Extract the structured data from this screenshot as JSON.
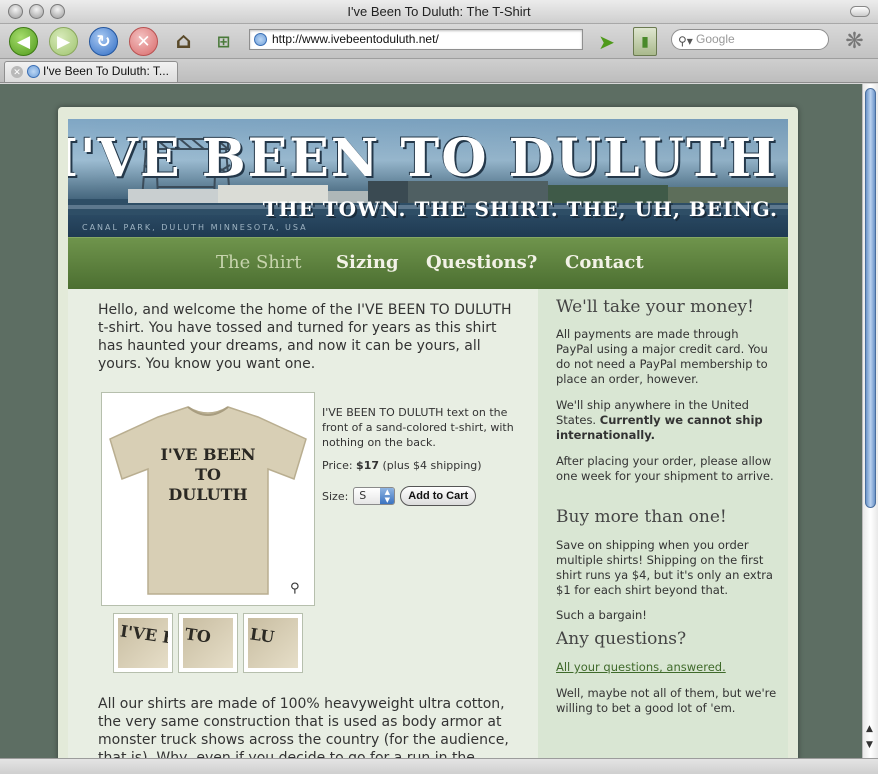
{
  "window": {
    "title": "I've Been To Duluth: The T-Shirt"
  },
  "toolbar": {
    "url": "http://www.ivebeentoduluth.net/",
    "search_placeholder": "Google"
  },
  "tabs": [
    {
      "label": "I've Been To Duluth: T..."
    }
  ],
  "banner": {
    "title": "I'VE BEEN TO DULUTH",
    "subtitle": "THE TOWN.  THE SHIRT.  THE, UH, BEING.",
    "caption": "CANAL PARK, DULUTH MINNESOTA, USA"
  },
  "nav": {
    "items": [
      {
        "label": "The Shirt"
      },
      {
        "label": "Sizing"
      },
      {
        "label": "Questions?"
      },
      {
        "label": "Contact"
      }
    ]
  },
  "main": {
    "intro": "Hello, and welcome the home of the I'VE BEEN TO DULUTH t-shirt. You have tossed and turned for years as this shirt has haunted your dreams, and now it can be yours, all yours. You know you want one.",
    "shirt_print": [
      "I'VE BEEN",
      "TO",
      "DULUTH"
    ],
    "product_description": "I'VE BEEN TO DULUTH text on the front of a sand-colored t-shirt, with nothing on the back.",
    "price_label": "Price:",
    "price_value": "$17",
    "price_note": "(plus $4 shipping)",
    "size_label": "Size:",
    "size_value": "S",
    "cart_button": "Add to Cart",
    "thumbnails": [
      {
        "text": "I'VE BE"
      },
      {
        "text": "TO"
      },
      {
        "text": "LU"
      }
    ],
    "more_text": "All our shirts are made of 100% heavyweight ultra cotton, the very same construction that is used as body armor at monster truck shows across the country (for the audience, that is). Why, even if you decide to go for a run in the"
  },
  "sidebar": {
    "h1": "We'll take your money!",
    "p1": "All payments are made through PayPal using a major credit card. You do not need a PayPal membership to place an order, however.",
    "p2_a": "We'll ship anywhere in the United States.",
    "p2_b": "Currently we cannot ship internationally.",
    "p3": "After placing your order, please allow one week for your shipment to arrive.",
    "h2": "Buy more than one!",
    "p4": "Save on shipping when you order multiple shirts! Shipping on the first shirt runs ya $4, but it's only an extra $1 for each shirt beyond that.",
    "p5": "Such a bargain!",
    "h3": "Any questions?",
    "link": "All your questions, answered.",
    "p6": "Well, maybe not all of them, but we're willing to bet a good lot of 'em."
  },
  "colors": {
    "nav_green": "#5a7d3b",
    "page_bg": "#5d6e63",
    "link_green": "#3f6a2a"
  }
}
